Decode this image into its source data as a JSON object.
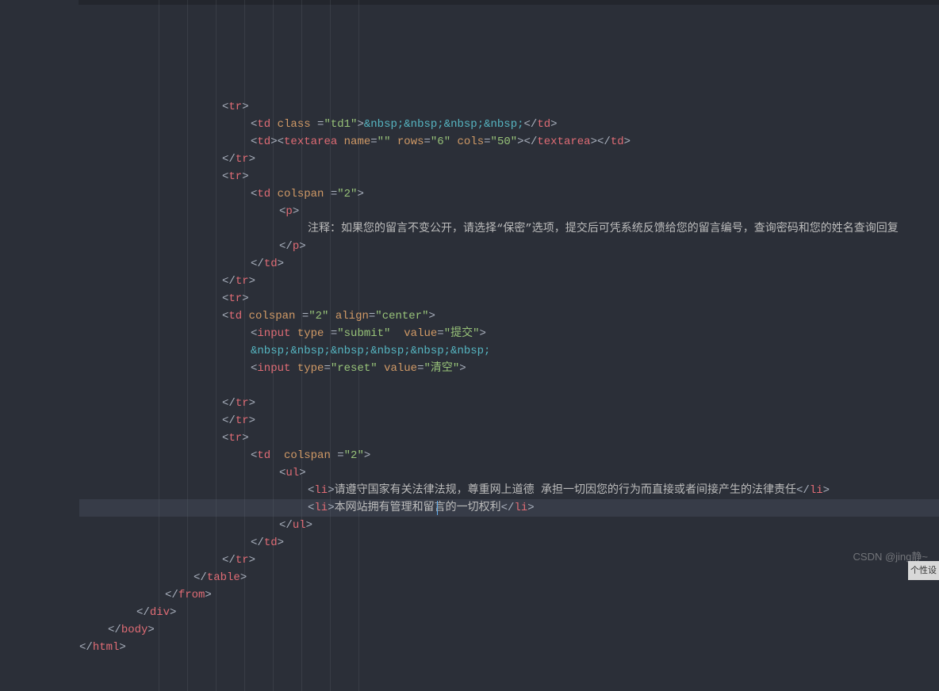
{
  "watermark": "CSDN @jing静~",
  "cornerLabel": "个性设",
  "indentGuides": [
    0,
    36,
    72,
    108,
    144,
    180,
    216,
    252
  ],
  "cursor": {
    "lineIndex": 23,
    "chOffsetPx": 451
  },
  "highlightLine": 23,
  "lines": [
    {
      "indent": 5,
      "tokens": [
        {
          "t": "punc",
          "v": "<"
        },
        {
          "t": "tag",
          "v": "tr"
        },
        {
          "t": "punc",
          "v": ">"
        }
      ]
    },
    {
      "indent": 6,
      "tokens": [
        {
          "t": "punc",
          "v": "<"
        },
        {
          "t": "tag",
          "v": "td"
        },
        {
          "t": "punc",
          "v": " "
        },
        {
          "t": "attr",
          "v": "class"
        },
        {
          "t": "punc",
          "v": " ="
        },
        {
          "t": "str",
          "v": "\"td1\""
        },
        {
          "t": "punc",
          "v": ">"
        },
        {
          "t": "entity",
          "v": "&nbsp;&nbsp;&nbsp;&nbsp;"
        },
        {
          "t": "punc",
          "v": "</"
        },
        {
          "t": "tag",
          "v": "td"
        },
        {
          "t": "punc",
          "v": ">"
        }
      ]
    },
    {
      "indent": 6,
      "tokens": [
        {
          "t": "punc",
          "v": "<"
        },
        {
          "t": "tag",
          "v": "td"
        },
        {
          "t": "punc",
          "v": "><"
        },
        {
          "t": "tag",
          "v": "textarea"
        },
        {
          "t": "punc",
          "v": " "
        },
        {
          "t": "attr",
          "v": "name"
        },
        {
          "t": "punc",
          "v": "="
        },
        {
          "t": "str",
          "v": "\"\""
        },
        {
          "t": "punc",
          "v": " "
        },
        {
          "t": "attr",
          "v": "rows"
        },
        {
          "t": "punc",
          "v": "="
        },
        {
          "t": "str",
          "v": "\"6\""
        },
        {
          "t": "punc",
          "v": " "
        },
        {
          "t": "attr",
          "v": "cols"
        },
        {
          "t": "punc",
          "v": "="
        },
        {
          "t": "str",
          "v": "\"50\""
        },
        {
          "t": "punc",
          "v": "></"
        },
        {
          "t": "tag",
          "v": "textarea"
        },
        {
          "t": "punc",
          "v": "></"
        },
        {
          "t": "tag",
          "v": "td"
        },
        {
          "t": "punc",
          "v": ">"
        }
      ]
    },
    {
      "indent": 5,
      "tokens": [
        {
          "t": "punc",
          "v": "</"
        },
        {
          "t": "tag",
          "v": "tr"
        },
        {
          "t": "punc",
          "v": ">"
        }
      ]
    },
    {
      "indent": 5,
      "tokens": [
        {
          "t": "punc",
          "v": "<"
        },
        {
          "t": "tag",
          "v": "tr"
        },
        {
          "t": "punc",
          "v": ">"
        }
      ]
    },
    {
      "indent": 6,
      "tokens": [
        {
          "t": "punc",
          "v": "<"
        },
        {
          "t": "tag",
          "v": "td"
        },
        {
          "t": "punc",
          "v": " "
        },
        {
          "t": "attr",
          "v": "colspan"
        },
        {
          "t": "punc",
          "v": " ="
        },
        {
          "t": "str",
          "v": "\"2\""
        },
        {
          "t": "punc",
          "v": ">"
        }
      ]
    },
    {
      "indent": 7,
      "tokens": [
        {
          "t": "punc",
          "v": "<"
        },
        {
          "t": "tag",
          "v": "p"
        },
        {
          "t": "punc",
          "v": ">"
        }
      ]
    },
    {
      "indent": 8,
      "tokens": [
        {
          "t": "text",
          "v": "注释：如果您的留言不变公开，请选择“保密”选项，提交后可凭系统反馈给您的留言编号，查询密码和您的姓名查询回复"
        }
      ]
    },
    {
      "indent": 7,
      "tokens": [
        {
          "t": "punc",
          "v": "</"
        },
        {
          "t": "tag",
          "v": "p"
        },
        {
          "t": "punc",
          "v": ">"
        }
      ]
    },
    {
      "indent": 6,
      "tokens": [
        {
          "t": "punc",
          "v": "</"
        },
        {
          "t": "tag",
          "v": "td"
        },
        {
          "t": "punc",
          "v": ">"
        }
      ]
    },
    {
      "indent": 5,
      "tokens": [
        {
          "t": "punc",
          "v": "</"
        },
        {
          "t": "tag",
          "v": "tr"
        },
        {
          "t": "punc",
          "v": ">"
        }
      ]
    },
    {
      "indent": 5,
      "tokens": [
        {
          "t": "punc",
          "v": "<"
        },
        {
          "t": "tag",
          "v": "tr"
        },
        {
          "t": "punc",
          "v": ">"
        }
      ]
    },
    {
      "indent": 5,
      "tokens": [
        {
          "t": "punc",
          "v": "<"
        },
        {
          "t": "tag",
          "v": "td"
        },
        {
          "t": "punc",
          "v": " "
        },
        {
          "t": "attr",
          "v": "colspan"
        },
        {
          "t": "punc",
          "v": " ="
        },
        {
          "t": "str",
          "v": "\"2\""
        },
        {
          "t": "punc",
          "v": " "
        },
        {
          "t": "attr",
          "v": "align"
        },
        {
          "t": "punc",
          "v": "="
        },
        {
          "t": "str",
          "v": "\"center\""
        },
        {
          "t": "punc",
          "v": ">"
        }
      ]
    },
    {
      "indent": 6,
      "tokens": [
        {
          "t": "punc",
          "v": "<"
        },
        {
          "t": "tag",
          "v": "input"
        },
        {
          "t": "punc",
          "v": " "
        },
        {
          "t": "attr",
          "v": "type"
        },
        {
          "t": "punc",
          "v": " ="
        },
        {
          "t": "str",
          "v": "\"submit\""
        },
        {
          "t": "punc",
          "v": "  "
        },
        {
          "t": "attr",
          "v": "value"
        },
        {
          "t": "punc",
          "v": "="
        },
        {
          "t": "str",
          "v": "\"提交\""
        },
        {
          "t": "punc",
          "v": ">"
        }
      ]
    },
    {
      "indent": 6,
      "tokens": [
        {
          "t": "entity",
          "v": "&nbsp;&nbsp;&nbsp;&nbsp;&nbsp;&nbsp;"
        }
      ]
    },
    {
      "indent": 6,
      "tokens": [
        {
          "t": "punc",
          "v": "<"
        },
        {
          "t": "tag",
          "v": "input"
        },
        {
          "t": "punc",
          "v": " "
        },
        {
          "t": "attr",
          "v": "type"
        },
        {
          "t": "punc",
          "v": "="
        },
        {
          "t": "str",
          "v": "\"reset\""
        },
        {
          "t": "punc",
          "v": " "
        },
        {
          "t": "attr",
          "v": "value"
        },
        {
          "t": "punc",
          "v": "="
        },
        {
          "t": "str",
          "v": "\"清空\""
        },
        {
          "t": "punc",
          "v": ">"
        }
      ]
    },
    {
      "indent": 0,
      "tokens": []
    },
    {
      "indent": 5,
      "tokens": [
        {
          "t": "punc",
          "v": "</"
        },
        {
          "t": "tag",
          "v": "tr"
        },
        {
          "t": "punc",
          "v": ">"
        }
      ]
    },
    {
      "indent": 5,
      "tokens": [
        {
          "t": "punc",
          "v": "</"
        },
        {
          "t": "tag",
          "v": "tr"
        },
        {
          "t": "punc",
          "v": ">"
        }
      ]
    },
    {
      "indent": 5,
      "tokens": [
        {
          "t": "punc",
          "v": "<"
        },
        {
          "t": "tag",
          "v": "tr"
        },
        {
          "t": "punc",
          "v": ">"
        }
      ]
    },
    {
      "indent": 6,
      "tokens": [
        {
          "t": "punc",
          "v": "<"
        },
        {
          "t": "tag",
          "v": "td"
        },
        {
          "t": "punc",
          "v": "  "
        },
        {
          "t": "attr",
          "v": "colspan"
        },
        {
          "t": "punc",
          "v": " ="
        },
        {
          "t": "str",
          "v": "\"2\""
        },
        {
          "t": "punc",
          "v": ">"
        }
      ]
    },
    {
      "indent": 7,
      "tokens": [
        {
          "t": "punc",
          "v": "<"
        },
        {
          "t": "tag",
          "v": "ul"
        },
        {
          "t": "punc",
          "v": ">"
        }
      ]
    },
    {
      "indent": 8,
      "tokens": [
        {
          "t": "punc",
          "v": "<"
        },
        {
          "t": "tag",
          "v": "li"
        },
        {
          "t": "punc",
          "v": ">"
        },
        {
          "t": "text",
          "v": "请遵守国家有关法律法规，尊重网上道德 承担一切因您的行为而直接或者间接产生的法律责任"
        },
        {
          "t": "punc",
          "v": "</"
        },
        {
          "t": "tag",
          "v": "li"
        },
        {
          "t": "punc",
          "v": ">"
        }
      ]
    },
    {
      "indent": 8,
      "tokens": [
        {
          "t": "punc",
          "v": "<"
        },
        {
          "t": "tag",
          "v": "li"
        },
        {
          "t": "punc",
          "v": ">"
        },
        {
          "t": "text",
          "v": "本网站拥有管理和留言的一切权利"
        },
        {
          "t": "punc",
          "v": "</"
        },
        {
          "t": "tag",
          "v": "li"
        },
        {
          "t": "punc",
          "v": ">"
        }
      ]
    },
    {
      "indent": 7,
      "tokens": [
        {
          "t": "punc",
          "v": "</"
        },
        {
          "t": "tag",
          "v": "ul"
        },
        {
          "t": "punc",
          "v": ">"
        }
      ]
    },
    {
      "indent": 6,
      "tokens": [
        {
          "t": "punc",
          "v": "</"
        },
        {
          "t": "tag",
          "v": "td"
        },
        {
          "t": "punc",
          "v": ">"
        }
      ]
    },
    {
      "indent": 5,
      "tokens": [
        {
          "t": "punc",
          "v": "</"
        },
        {
          "t": "tag",
          "v": "tr"
        },
        {
          "t": "punc",
          "v": ">"
        }
      ]
    },
    {
      "indent": 4,
      "tokens": [
        {
          "t": "punc",
          "v": "</"
        },
        {
          "t": "tag",
          "v": "table"
        },
        {
          "t": "punc",
          "v": ">"
        }
      ]
    },
    {
      "indent": 3,
      "tokens": [
        {
          "t": "punc",
          "v": "</"
        },
        {
          "t": "tag",
          "v": "from"
        },
        {
          "t": "punc",
          "v": ">"
        }
      ]
    },
    {
      "indent": 2,
      "tokens": [
        {
          "t": "punc",
          "v": "</"
        },
        {
          "t": "tag",
          "v": "div"
        },
        {
          "t": "punc",
          "v": ">"
        }
      ]
    },
    {
      "indent": 1,
      "tokens": [
        {
          "t": "punc",
          "v": "</"
        },
        {
          "t": "tag",
          "v": "body"
        },
        {
          "t": "punc",
          "v": ">"
        }
      ]
    },
    {
      "indent": 0,
      "tokens": [
        {
          "t": "punc",
          "v": "</"
        },
        {
          "t": "tag",
          "v": "html"
        },
        {
          "t": "punc",
          "v": ">"
        }
      ]
    }
  ]
}
